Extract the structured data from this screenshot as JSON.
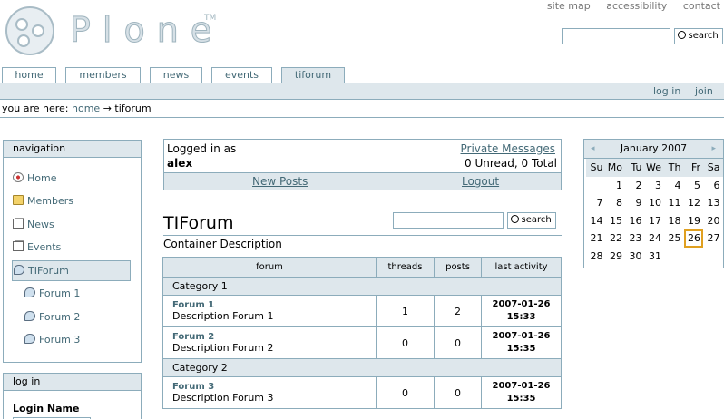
{
  "header": {
    "logo_text": "Plone",
    "logo_tm": "TM",
    "site_actions": [
      "site map",
      "accessibility",
      "contact"
    ],
    "search_label": "search"
  },
  "tabs": [
    {
      "label": "home"
    },
    {
      "label": "members"
    },
    {
      "label": "news"
    },
    {
      "label": "events"
    },
    {
      "label": "tiforum",
      "active": true
    }
  ],
  "personal_bar": {
    "login": "log in",
    "join": "join"
  },
  "breadcrumb": {
    "prefix": "you are here:",
    "home": "home",
    "arrow": "→",
    "current": "tiforum"
  },
  "navigation": {
    "title": "navigation",
    "items": [
      {
        "label": "Home",
        "icon": "home-icon"
      },
      {
        "label": "Members",
        "icon": "folder-icon"
      },
      {
        "label": "News",
        "icon": "document-icon"
      },
      {
        "label": "Events",
        "icon": "document-icon"
      },
      {
        "label": "TIForum",
        "icon": "forum-icon",
        "active": true
      },
      {
        "label": "Forum 1",
        "icon": "forum-icon"
      },
      {
        "label": "Forum 2",
        "icon": "forum-icon"
      },
      {
        "label": "Forum 3",
        "icon": "forum-icon"
      }
    ]
  },
  "login_portlet": {
    "title": "log in",
    "login_name_label": "Login Name"
  },
  "user_box": {
    "logged_in_as": "Logged in as",
    "username": "alex",
    "private_messages": "Private Messages",
    "message_counts": "0 Unread, 0 Total",
    "new_posts": "New Posts",
    "logout": "Logout"
  },
  "forum": {
    "title": "TIForum",
    "description": "Container Description",
    "search_label": "search",
    "columns": [
      "forum",
      "threads",
      "posts",
      "last activity"
    ],
    "categories": [
      {
        "name": "Category 1",
        "forums": [
          {
            "name": "Forum 1",
            "description": "Description Forum 1",
            "threads": "1",
            "posts": "2",
            "date": "2007-01-26",
            "time": "15:33"
          },
          {
            "name": "Forum 2",
            "description": "Description Forum 2",
            "threads": "0",
            "posts": "0",
            "date": "2007-01-26",
            "time": "15:35"
          }
        ]
      },
      {
        "name": "Category 2",
        "forums": [
          {
            "name": "Forum 3",
            "description": "Description Forum 3",
            "threads": "0",
            "posts": "0",
            "date": "2007-01-26",
            "time": "15:35"
          }
        ]
      }
    ]
  },
  "calendar": {
    "month_label": "January 2007",
    "prev": "◂",
    "next": "▸",
    "day_headers": [
      "Su",
      "Mo",
      "Tu",
      "We",
      "Th",
      "Fr",
      "Sa"
    ],
    "weeks": [
      [
        "",
        "1",
        "2",
        "3",
        "4",
        "5",
        "6"
      ],
      [
        "7",
        "8",
        "9",
        "10",
        "11",
        "12",
        "13"
      ],
      [
        "14",
        "15",
        "16",
        "17",
        "18",
        "19",
        "20"
      ],
      [
        "21",
        "22",
        "23",
        "24",
        "25",
        "26",
        "27"
      ],
      [
        "28",
        "29",
        "30",
        "31",
        "",
        "",
        ""
      ]
    ],
    "today": "26",
    "today_color": "#e0a020"
  },
  "colors": {
    "accent_bg": "#dee7ec",
    "border": "#8cacbb",
    "link": "#436976"
  }
}
